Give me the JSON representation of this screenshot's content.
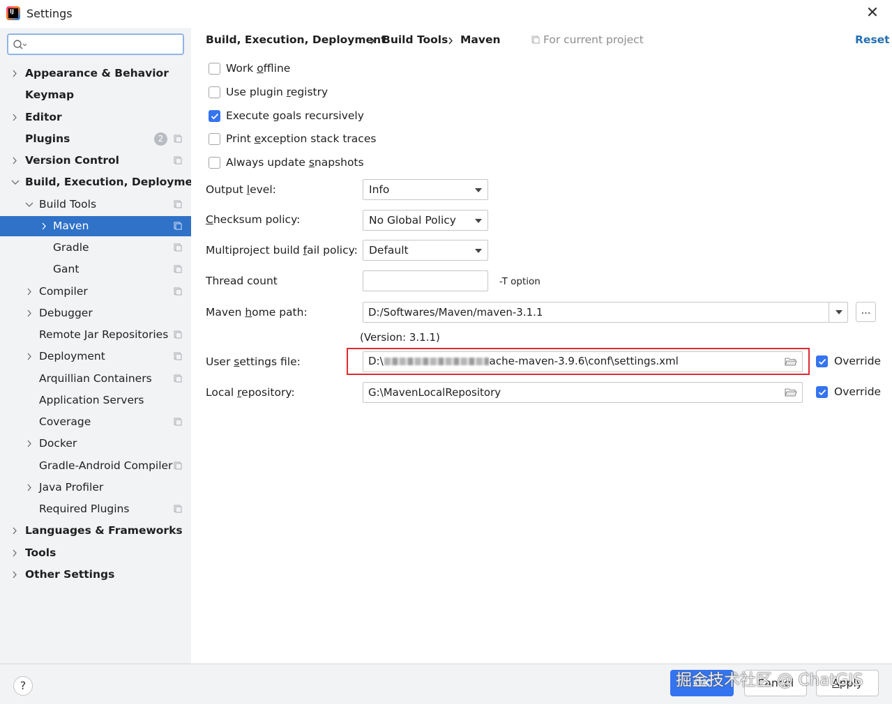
{
  "window": {
    "title": "Settings"
  },
  "search": {
    "placeholder": ""
  },
  "sidebar": {
    "items": [
      {
        "label": "Appearance & Behavior"
      },
      {
        "label": "Keymap"
      },
      {
        "label": "Editor"
      },
      {
        "label": "Plugins",
        "badge": "2"
      },
      {
        "label": "Version Control"
      },
      {
        "label": "Build, Execution, Deployment"
      },
      {
        "label": "Build Tools"
      },
      {
        "label": "Maven"
      },
      {
        "label": "Gradle"
      },
      {
        "label": "Gant"
      },
      {
        "label": "Compiler"
      },
      {
        "label": "Debugger"
      },
      {
        "label": "Remote Jar Repositories"
      },
      {
        "label": "Deployment"
      },
      {
        "label": "Arquillian Containers"
      },
      {
        "label": "Application Servers"
      },
      {
        "label": "Coverage"
      },
      {
        "label": "Docker"
      },
      {
        "label": "Gradle-Android Compiler"
      },
      {
        "label": "Java Profiler"
      },
      {
        "label": "Required Plugins"
      },
      {
        "label": "Languages & Frameworks"
      },
      {
        "label": "Tools"
      },
      {
        "label": "Other Settings"
      }
    ]
  },
  "breadcrumb": {
    "items": [
      "Build, Execution, Deployment",
      "Build Tools",
      "Maven"
    ],
    "scope": "For current project",
    "reset": "Reset"
  },
  "options": {
    "work_offline": {
      "pre": "Work ",
      "u": "o",
      "post": "ffline",
      "checked": false
    },
    "use_plugin_registry": {
      "pre": "Use plugin ",
      "u": "r",
      "post": "egistry",
      "checked": false
    },
    "execute_goals": {
      "pre": "Execute ",
      "u": "g",
      "post": "oals recursively",
      "checked": true
    },
    "print_exception": {
      "pre": "Print ",
      "u": "e",
      "post": "xception stack traces",
      "checked": false
    },
    "always_update": {
      "pre": "Always update ",
      "u": "s",
      "post": "napshots",
      "checked": false
    }
  },
  "fields": {
    "output_level": {
      "pre": "Output ",
      "u": "l",
      "post": "evel:",
      "value": "Info"
    },
    "checksum_policy": {
      "pre": "",
      "u": "C",
      "post": "hecksum policy:",
      "value": "No Global Policy"
    },
    "multiproject_fail": {
      "pre": "Multiproject build ",
      "u": "f",
      "post": "ail policy:",
      "value": "Default"
    },
    "thread_count": {
      "label": "Thread count",
      "value": "",
      "hint": "-T option"
    },
    "maven_home": {
      "pre": "Maven ",
      "u": "h",
      "post": "ome path:",
      "value": "D:/Softwares/Maven/maven-3.1.1",
      "version": "(Version: 3.1.1)"
    },
    "user_settings": {
      "pre": "User ",
      "u": "s",
      "post": "ettings file:",
      "value_start": "D:\\",
      "value_end": "ache-maven-3.9.6\\conf\\settings.xml",
      "override": "Override"
    },
    "local_repo": {
      "pre": "Local ",
      "u": "r",
      "post": "epository:",
      "value": "G:\\MavenLocalRepository",
      "override": "Override"
    }
  },
  "footer": {
    "help": "?",
    "ok": "OK",
    "cancel": "Cancel",
    "apply_u": "A",
    "apply_rest": "pply",
    "watermark": "掘金技术社区 @ ChatGIS"
  },
  "colors": {
    "accent": "#3574f0",
    "selection": "#2f72c8",
    "link": "#2470b3",
    "highlight": "#e0282e"
  }
}
